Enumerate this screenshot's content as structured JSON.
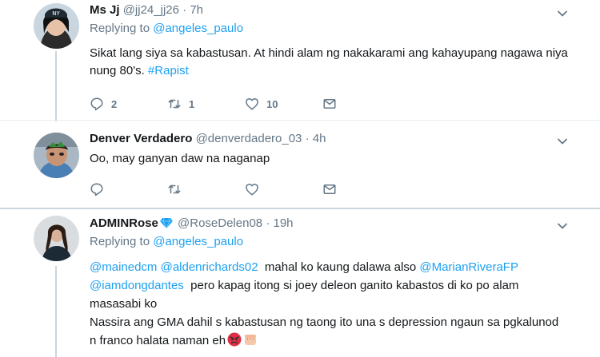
{
  "tweets": [
    {
      "name": "Ms Jj",
      "handle": "@jj24_jj26",
      "dot": "·",
      "time": "7h",
      "replying_prefix": "Replying to ",
      "replying_to": "@angeles_paulo",
      "text_plain": "Sikat lang siya sa kabastusan. At hindi alam ng nakakarami ang kahayupang nagawa niya nung 80's. ",
      "hashtag": "#Rapist",
      "reply_count": "2",
      "retweet_count": "1",
      "like_count": "10"
    },
    {
      "name": "Denver Verdadero",
      "handle": "@denverdadero_03",
      "dot": "·",
      "time": "4h",
      "text": "Oo, may ganyan daw na naganap",
      "reply_count": "",
      "retweet_count": "",
      "like_count": ""
    },
    {
      "name": "ADMINRose",
      "handle": "@RoseDelen08",
      "dot": "·",
      "time": "19h",
      "replying_prefix": "Replying to ",
      "replying_to": "@angeles_paulo",
      "mention1": "@mainedcm",
      "mention2": "@aldenrichards02",
      "text_a": "  mahal ko kaung dalawa also ",
      "mention3": "@MarianRiveraFP",
      "mention4": "@iamdongdantes",
      "text_b": "  pero kapag itong si joey deleon ganito kabastos di ko po alam masasabi ko",
      "text_c": "Nassira ang GMA dahil s kabastusan ng taong ito una s depression ngaun sa pgkalunod n franco halata naman eh"
    }
  ],
  "colors": {
    "link": "#1da1f2",
    "muted": "#657786",
    "verified": "#1da1f2",
    "thread_line": "#ccd6dd"
  },
  "icons": {
    "reply": "reply-icon",
    "retweet": "retweet-icon",
    "like": "heart-icon",
    "dm": "envelope-icon",
    "caret": "chevron-down-icon",
    "verified": "diamond-icon"
  }
}
